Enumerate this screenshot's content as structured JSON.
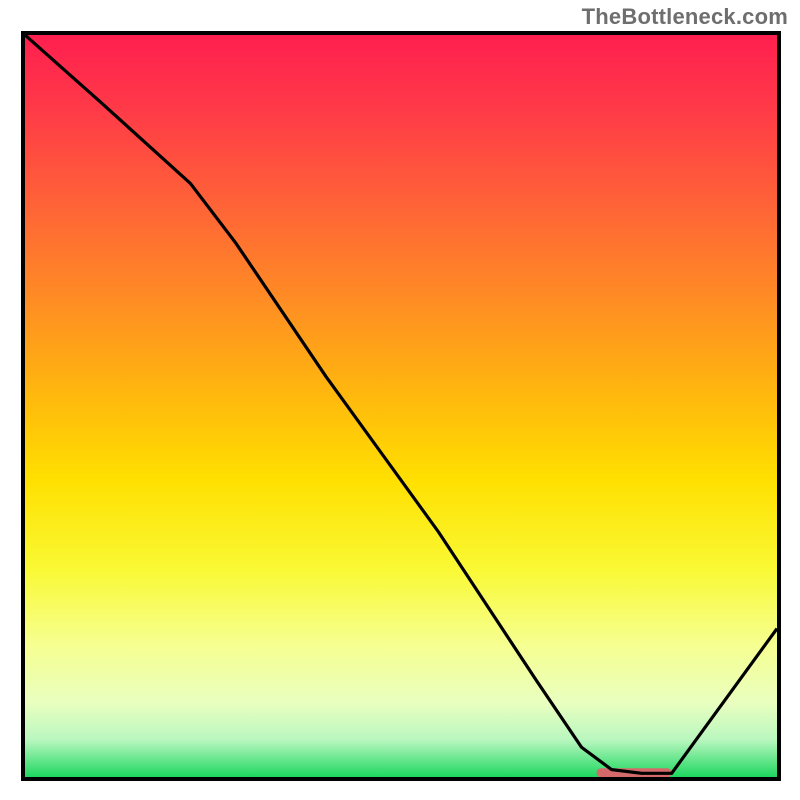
{
  "watermark": "TheBottleneck.com",
  "colors": {
    "border": "#000000",
    "curve": "#000000",
    "marker": "#d46a6a",
    "gradient_stops": [
      {
        "offset": 0.0,
        "color": "#ff1f4f"
      },
      {
        "offset": 0.1,
        "color": "#ff3a48"
      },
      {
        "offset": 0.22,
        "color": "#ff6038"
      },
      {
        "offset": 0.35,
        "color": "#ff8a25"
      },
      {
        "offset": 0.48,
        "color": "#ffb60e"
      },
      {
        "offset": 0.6,
        "color": "#ffe000"
      },
      {
        "offset": 0.72,
        "color": "#f9f934"
      },
      {
        "offset": 0.82,
        "color": "#f6ff8f"
      },
      {
        "offset": 0.9,
        "color": "#e9ffbf"
      },
      {
        "offset": 0.95,
        "color": "#b9f7bf"
      },
      {
        "offset": 1.0,
        "color": "#1ed760"
      }
    ]
  },
  "chart_data": {
    "type": "line",
    "title": "",
    "xlabel": "",
    "ylabel": "",
    "xlim": [
      0,
      100
    ],
    "ylim": [
      0,
      100
    ],
    "grid": false,
    "legend": false,
    "series": [
      {
        "name": "curve",
        "x": [
          0,
          10,
          22,
          28,
          40,
          55,
          68,
          74,
          78,
          82,
          86,
          100
        ],
        "y": [
          100,
          91,
          80,
          72,
          54,
          33,
          13,
          4,
          1,
          0.5,
          0.5,
          20
        ]
      }
    ],
    "marker": {
      "x_start": 76,
      "x_end": 86,
      "y": 0.5
    }
  }
}
